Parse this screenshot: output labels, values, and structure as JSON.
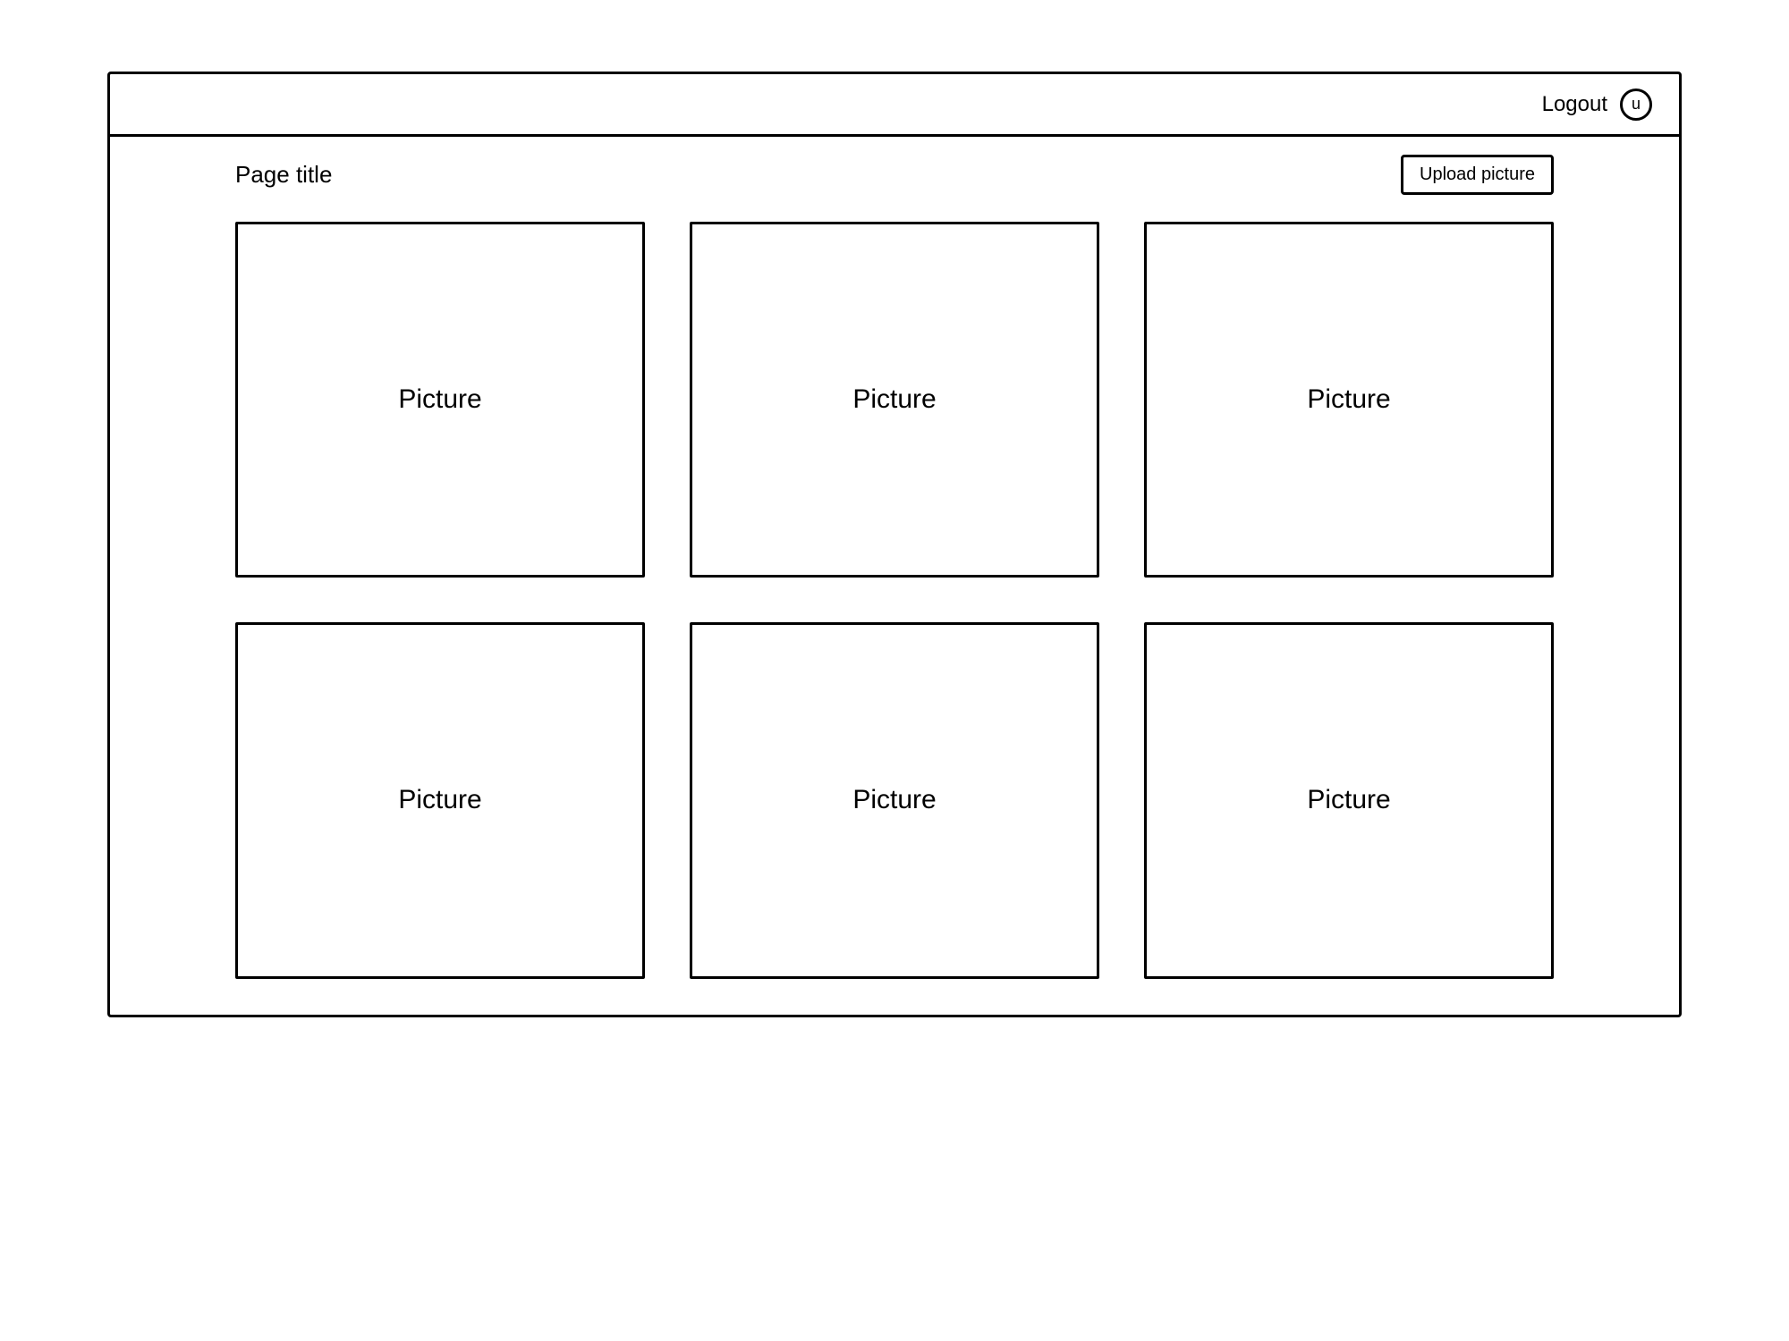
{
  "header": {
    "logout_label": "Logout",
    "avatar_initial": "u"
  },
  "main": {
    "title": "Page title",
    "upload_button_label": "Upload picture",
    "pictures": [
      {
        "label": "Picture"
      },
      {
        "label": "Picture"
      },
      {
        "label": "Picture"
      },
      {
        "label": "Picture"
      },
      {
        "label": "Picture"
      },
      {
        "label": "Picture"
      }
    ]
  }
}
